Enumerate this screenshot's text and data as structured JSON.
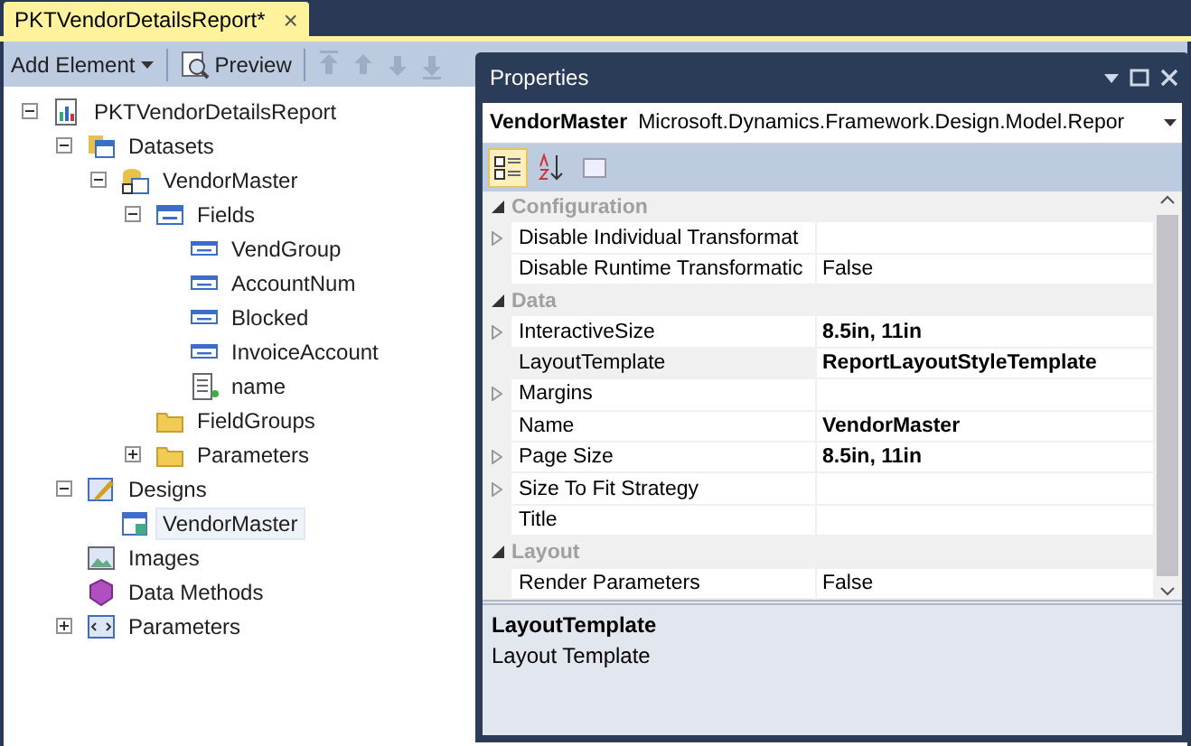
{
  "document_tab": {
    "title": "PKTVendorDetailsReport*",
    "close": "×",
    "selected": true
  },
  "toolbar": {
    "add_element": "Add Element",
    "preview": "Preview",
    "move_buttons": [
      {
        "kind": "top",
        "disabled": true
      },
      {
        "kind": "up",
        "disabled": true
      },
      {
        "kind": "down",
        "disabled": true
      },
      {
        "kind": "bottom",
        "disabled": true
      }
    ]
  },
  "tree": [
    {
      "label": "PKTVendorDetailsReport",
      "kind": "report",
      "expanded": true,
      "selected": false,
      "children": [
        {
          "label": "Datasets",
          "kind": "datasets",
          "expanded": true,
          "selected": false,
          "children": [
            {
              "label": "VendorMaster",
              "kind": "dataset",
              "expanded": true,
              "selected": false,
              "children": [
                {
                  "label": "Fields",
                  "kind": "fields",
                  "expanded": true,
                  "selected": false,
                  "children": [
                    {
                      "label": "VendGroup",
                      "kind": "field",
                      "selected": false
                    },
                    {
                      "label": "AccountNum",
                      "kind": "field",
                      "selected": false
                    },
                    {
                      "label": "Blocked",
                      "kind": "field",
                      "selected": false
                    },
                    {
                      "label": "InvoiceAccount",
                      "kind": "field",
                      "selected": false
                    },
                    {
                      "label": "name",
                      "kind": "method",
                      "selected": false
                    }
                  ]
                },
                {
                  "label": "FieldGroups",
                  "kind": "folder",
                  "selected": false
                },
                {
                  "label": "Parameters",
                  "kind": "folder",
                  "expanded": false,
                  "selected": false
                }
              ]
            }
          ]
        },
        {
          "label": "Designs",
          "kind": "designs",
          "expanded": true,
          "selected": false,
          "children": [
            {
              "label": "VendorMaster",
              "kind": "design",
              "selected": true
            }
          ]
        },
        {
          "label": "Images",
          "kind": "images",
          "selected": false
        },
        {
          "label": "Data Methods",
          "kind": "datamethods",
          "selected": false
        },
        {
          "label": "Parameters",
          "kind": "parameters",
          "expanded": false,
          "selected": false
        }
      ]
    }
  ],
  "properties": {
    "title": "Properties",
    "object_name": "VendorMaster",
    "object_type": "Microsoft.Dynamics.Framework.Design.Model.Repor",
    "view_buttons": [
      {
        "kind": "categorized",
        "selected": true
      },
      {
        "kind": "alphabetical",
        "selected": false
      },
      {
        "kind": "pages",
        "selected": false
      }
    ],
    "rows": [
      {
        "kind": "category",
        "label": "Configuration",
        "expanded": true
      },
      {
        "kind": "property",
        "label": "Disable Individual Transformat",
        "value": "",
        "expandable": true,
        "selected": false
      },
      {
        "kind": "property",
        "label": "Disable Runtime Transformatic",
        "value": "False",
        "expandable": false,
        "modified": false,
        "selected": false
      },
      {
        "kind": "category",
        "label": "Data",
        "expanded": true
      },
      {
        "kind": "property",
        "label": "InteractiveSize",
        "value": "8.5in, 11in",
        "expandable": true,
        "modified": true,
        "selected": false
      },
      {
        "kind": "property",
        "label": "LayoutTemplate",
        "value": "ReportLayoutStyleTemplate",
        "expandable": false,
        "modified": true,
        "selected": true
      },
      {
        "kind": "property",
        "label": "Margins",
        "value": "",
        "expandable": true,
        "selected": false
      },
      {
        "kind": "property",
        "label": "Name",
        "value": "VendorMaster",
        "expandable": false,
        "modified": true,
        "selected": false
      },
      {
        "kind": "property",
        "label": "Page Size",
        "value": "8.5in, 11in",
        "expandable": true,
        "modified": true,
        "selected": false
      },
      {
        "kind": "property",
        "label": "Size To Fit Strategy",
        "value": "",
        "expandable": true,
        "selected": false
      },
      {
        "kind": "property",
        "label": "Title",
        "value": "",
        "expandable": false,
        "selected": false
      },
      {
        "kind": "category",
        "label": "Layout",
        "expanded": true
      },
      {
        "kind": "property",
        "label": "Render Parameters",
        "value": "False",
        "expandable": false,
        "modified": false,
        "selected": false
      }
    ],
    "description": {
      "title": "LayoutTemplate",
      "text": "Layout Template"
    }
  }
}
